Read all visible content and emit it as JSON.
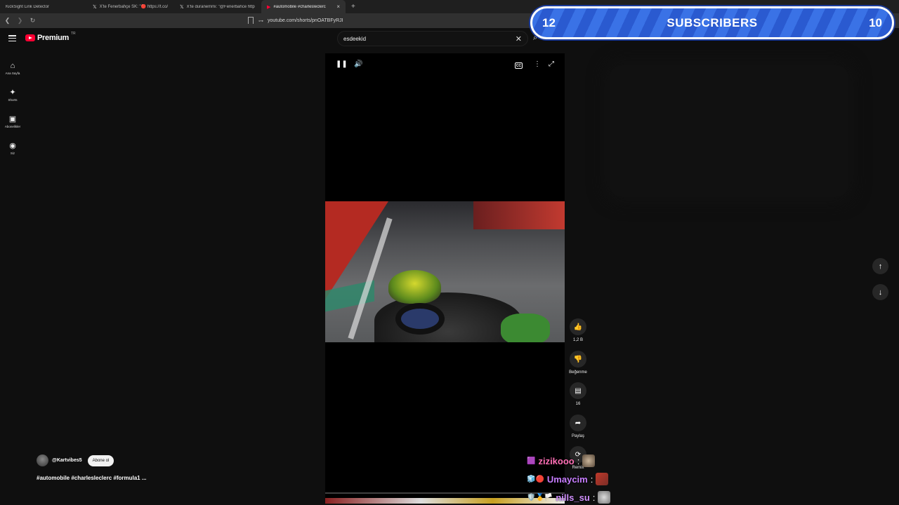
{
  "browser": {
    "tabs": [
      {
        "icon": "kicksight-icon",
        "label": "KickSight Link Detector",
        "active": false
      },
      {
        "icon": "x-icon",
        "label": "X'te Fenerbahçe SK: \"🔴 https://t.co/",
        "active": false
      },
      {
        "icon": "x-icon",
        "label": "X'te duranemmi: \"@Fenerbahce http",
        "active": false
      },
      {
        "icon": "youtube-icon",
        "label": "#automobile #charlesleclerc",
        "active": true
      }
    ],
    "new_tab": "+",
    "url": "youtube.com/shorts/pnOATBFyRJI"
  },
  "youtube": {
    "logo_text": "Premium",
    "logo_region": "TR",
    "search": {
      "value": "esdeekid",
      "clear": "✕"
    },
    "sidebar": [
      {
        "icon": "home-icon",
        "glyph": "⌂",
        "label": "Ana Sayfa"
      },
      {
        "icon": "shorts-icon",
        "glyph": "✦",
        "label": "Shorts"
      },
      {
        "icon": "subscriptions-icon",
        "glyph": "▣",
        "label": "Abonelikler"
      },
      {
        "icon": "account-icon",
        "glyph": "◉",
        "label": "Siz"
      }
    ],
    "player": {
      "pause": "❚❚",
      "volume": "🔊",
      "cc": "CC",
      "more": "⋮",
      "fullscreen": "⤢",
      "progress": 0.0
    },
    "actions": [
      {
        "name": "like",
        "glyph": "👍",
        "label": "1,2 B"
      },
      {
        "name": "dislike",
        "glyph": "👎",
        "label": "Beğenme"
      },
      {
        "name": "comments",
        "glyph": "▤",
        "label": "16"
      },
      {
        "name": "share",
        "glyph": "➦",
        "label": "Paylaş"
      },
      {
        "name": "remix",
        "glyph": "⟳",
        "label": "Remix"
      }
    ],
    "channel": {
      "name": "@Kartvibes5",
      "subscribe_label": "Abone ol"
    },
    "video_title": "#automobile #charlesleclerc #formula1 ...",
    "nav": {
      "up": "↑",
      "down": "↓"
    }
  },
  "overlay": {
    "left_number": "12",
    "label": "SUBSCRIBERS",
    "right_number": "10"
  },
  "chat": [
    {
      "badges": "🟪",
      "user": "zizikooo",
      "color": "#ff6fb5"
    },
    {
      "badges": "🧊🔴",
      "user": "Umaycim",
      "color": "#c77dff"
    },
    {
      "badges": "🛡️🥇🏳️",
      "user": "nills_su",
      "color": "#d291ff"
    }
  ]
}
